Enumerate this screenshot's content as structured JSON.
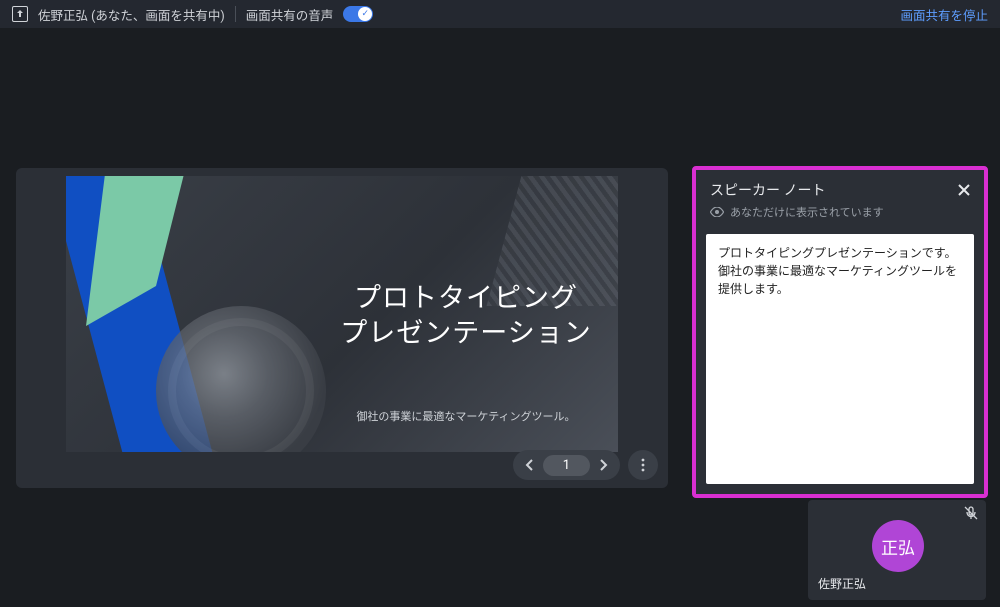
{
  "topbar": {
    "presenter_label": "佐野正弘 (あなた、画面を共有中)",
    "audio_label": "画面共有の音声",
    "stop_label": "画面共有を停止"
  },
  "slide": {
    "title_line1": "プロトタイピング",
    "title_line2": "プレゼンテーション",
    "subtitle": "御社の事業に最適なマーケティングツール。",
    "current_page": "1"
  },
  "notes": {
    "title": "スピーカー ノート",
    "visibility": "あなただけに表示されています",
    "body": "プロトタイピングプレゼンテーションです。\n御社の事業に最適なマーケティングツールを提供します。"
  },
  "participant": {
    "avatar_text": "正弘",
    "name": "佐野正弘"
  }
}
